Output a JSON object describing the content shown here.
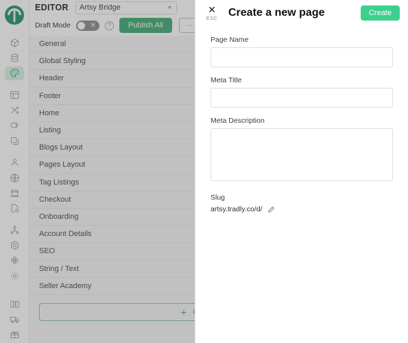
{
  "brand": {
    "logo_icon": "tradly-logo-icon",
    "accent_green": "#3aa971",
    "bright_green": "#3ecf8e",
    "active_rail_bg": "#d9f0e2"
  },
  "rail": {
    "items": [
      {
        "icon": "cube-icon",
        "active": false
      },
      {
        "icon": "database-icon",
        "active": false
      },
      {
        "icon": "paint-palette-icon",
        "active": true
      },
      {
        "icon": "layout-icon",
        "active": false
      },
      {
        "icon": "shuffle-icon",
        "active": false
      },
      {
        "icon": "coins-icon",
        "active": false
      },
      {
        "icon": "copy-icon",
        "active": false
      },
      {
        "icon": "user-icon",
        "active": false
      },
      {
        "icon": "globe-icon",
        "active": false
      },
      {
        "icon": "store-icon",
        "active": false
      },
      {
        "icon": "file-search-icon",
        "active": false
      },
      {
        "icon": "share-network-icon",
        "active": false
      },
      {
        "icon": "hexagon-badge-icon",
        "active": false
      },
      {
        "icon": "flower-icon",
        "active": false
      },
      {
        "icon": "gear-icon",
        "active": false
      },
      {
        "icon": "book-icon",
        "active": false
      },
      {
        "icon": "truck-icon",
        "active": false
      },
      {
        "icon": "gift-icon",
        "active": false
      }
    ]
  },
  "editor": {
    "title": "EDITOR",
    "site_select": {
      "value": "Artsy Bridge",
      "chevron": "chevron-down-icon"
    },
    "draft_mode": {
      "label": "Draft Mode",
      "enabled": false,
      "mark": "✕"
    },
    "help": "?",
    "publish_label": "Publish All",
    "more_label": "···",
    "menu_items": [
      {
        "label": "General",
        "has_edit": false,
        "has_delete": false
      },
      {
        "label": "Global Styling",
        "has_edit": false,
        "has_delete": false
      },
      {
        "label": "Header",
        "has_edit": false,
        "has_delete": false
      },
      {
        "label": "Footer",
        "has_edit": false,
        "has_delete": false
      },
      {
        "label": "Home",
        "has_edit": false,
        "has_delete": false
      },
      {
        "label": "Listing",
        "has_edit": false,
        "has_delete": false
      },
      {
        "label": "Blogs Layout",
        "has_edit": false,
        "has_delete": false
      },
      {
        "label": "Pages Layout",
        "has_edit": false,
        "has_delete": false
      },
      {
        "label": "Tag Listings",
        "has_edit": false,
        "has_delete": false
      },
      {
        "label": "Checkout",
        "has_edit": false,
        "has_delete": false
      },
      {
        "label": "Onboarding",
        "has_edit": false,
        "has_delete": false
      },
      {
        "label": "Account Details",
        "has_edit": false,
        "has_delete": false
      },
      {
        "label": "SEO",
        "has_edit": false,
        "has_delete": false
      },
      {
        "label": "String / Text",
        "has_edit": false,
        "has_delete": false
      },
      {
        "label": "Seller Academy",
        "has_edit": true,
        "has_delete": true
      }
    ],
    "create_page_button": {
      "label": "Create a new page",
      "plus": "+"
    }
  },
  "panel": {
    "close_icon": "close-icon",
    "close_hint": "ESC",
    "title": "Create a new page",
    "create_label": "Create",
    "fields": {
      "page_name": {
        "label": "Page Name",
        "value": "",
        "placeholder": ""
      },
      "meta_title": {
        "label": "Meta Title",
        "value": "",
        "placeholder": ""
      },
      "meta_description": {
        "label": "Meta Description",
        "value": "",
        "placeholder": ""
      }
    },
    "slug": {
      "label": "Slug",
      "value": "artsy.tradly.co/d/",
      "edit_icon": "pencil-icon"
    }
  }
}
